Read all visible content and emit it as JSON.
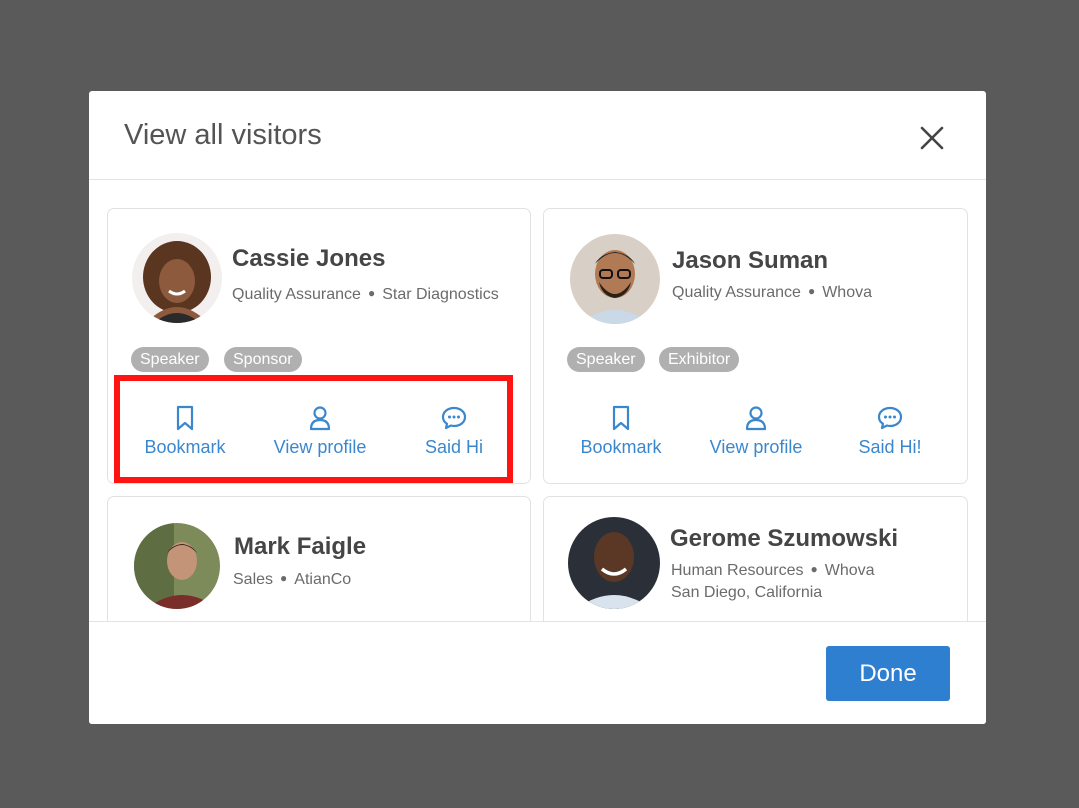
{
  "modal": {
    "title": "View all visitors",
    "done_label": "Done"
  },
  "visitors": [
    {
      "name": "Cassie Jones",
      "role": "Quality Assurance",
      "company": "Star Diagnostics",
      "tags": [
        "Speaker",
        "Sponsor"
      ],
      "actions": {
        "bookmark": "Bookmark",
        "view_profile": "View profile",
        "say_hi": "Said Hi"
      }
    },
    {
      "name": "Jason Suman",
      "role": "Quality Assurance",
      "company": "Whova",
      "tags": [
        "Speaker",
        "Exhibitor"
      ],
      "actions": {
        "bookmark": "Bookmark",
        "view_profile": "View profile",
        "say_hi": "Said Hi!"
      }
    },
    {
      "name": "Mark Faigle",
      "role": "Sales",
      "company": "AtianCo"
    },
    {
      "name": "Gerome Szumowski",
      "role": "Human Resources",
      "company": "Whova",
      "location": "San Diego, California"
    }
  ],
  "colors": {
    "accent": "#2f7fd0",
    "link": "#3b87cf",
    "tag": "#b0b0b0",
    "highlight": "#ff1414",
    "overlay": "#595a59"
  },
  "icons": [
    "close-icon",
    "bookmark-icon",
    "person-icon",
    "chat-bubble-icon"
  ]
}
